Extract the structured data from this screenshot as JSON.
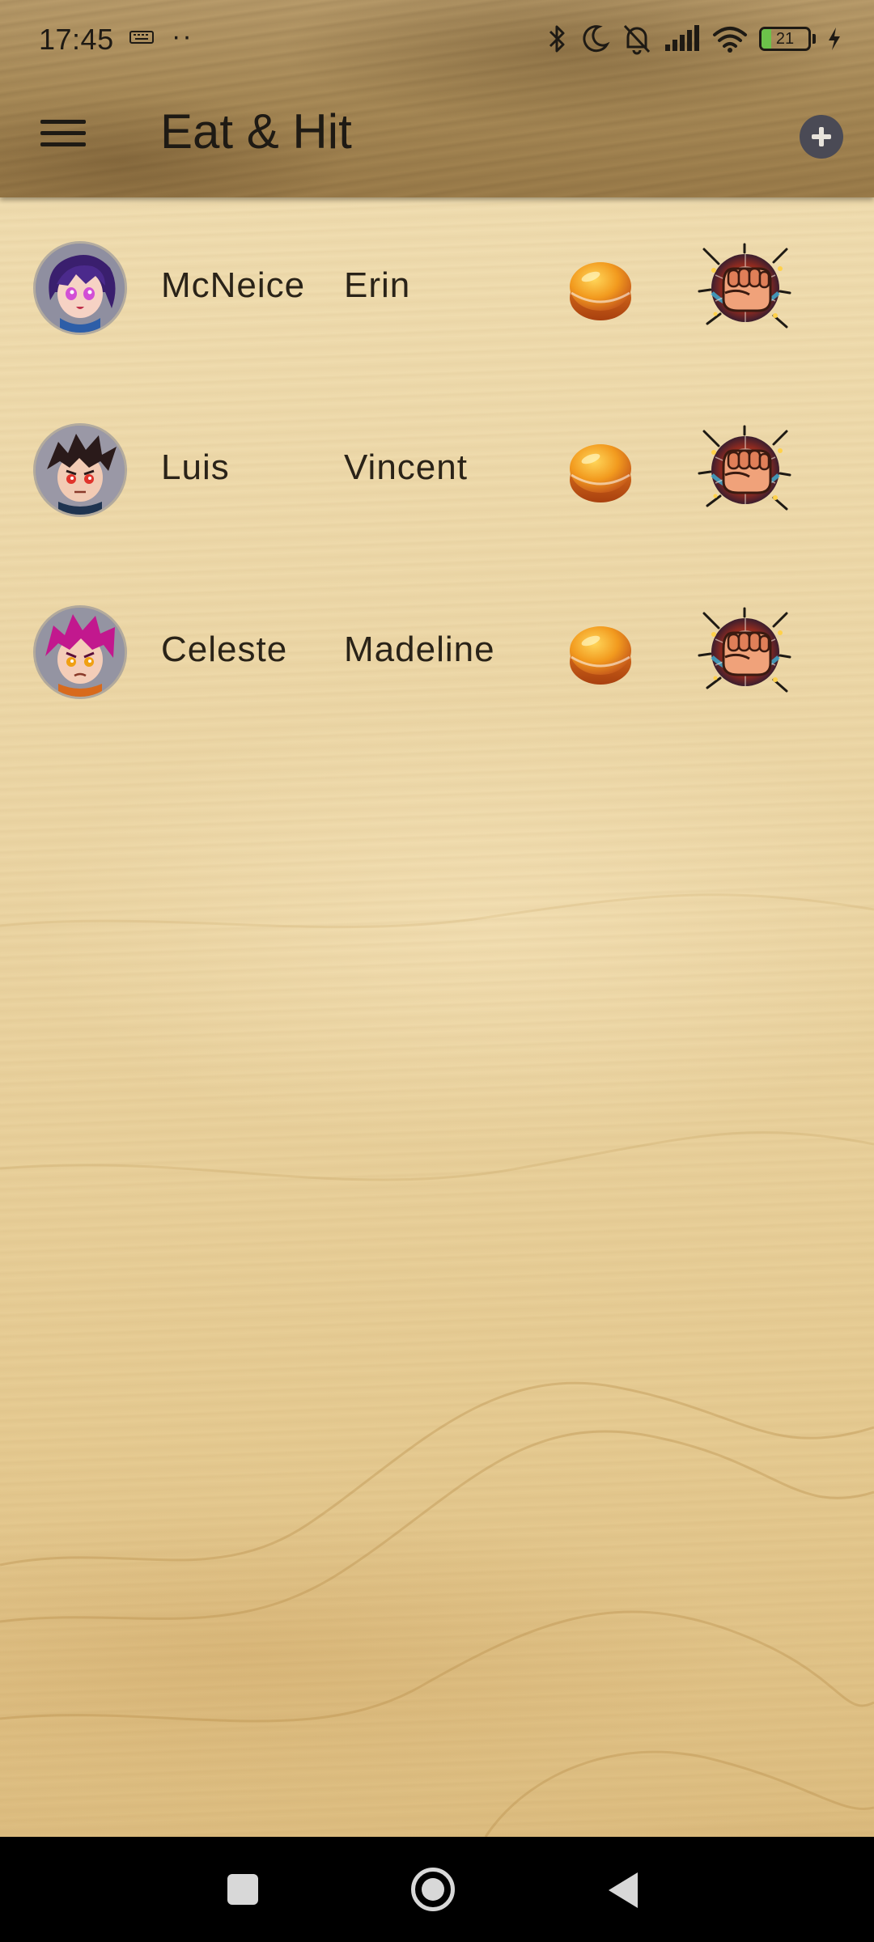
{
  "status_bar": {
    "time": "17:45",
    "battery_level": "21",
    "battery_fraction": 0.21,
    "icons": [
      "keyboard-icon",
      "bluetooth-icon",
      "do-not-disturb-icon",
      "muted-bell-icon",
      "signal-icon",
      "wifi-icon",
      "battery-icon",
      "charging-icon"
    ]
  },
  "app_bar": {
    "title": "Eat & Hit",
    "menu_icon": "hamburger-menu-icon",
    "add_icon": "add-circle-icon"
  },
  "players": [
    {
      "last_name": "McNeice",
      "first_name": "Erin",
      "avatar": "purple-hair-girl-avatar"
    },
    {
      "last_name": "Luis",
      "first_name": "Vincent",
      "avatar": "red-eyes-boy-avatar"
    },
    {
      "last_name": "Celeste",
      "first_name": "Madeline",
      "avatar": "pink-hair-girl-avatar"
    }
  ],
  "row_actions": {
    "eat_icon": "bread-bun-icon",
    "hit_icon": "fist-punch-icon"
  },
  "nav_bar": {
    "buttons": [
      "recents-button",
      "home-button",
      "back-button"
    ]
  },
  "colors": {
    "accent_dark": "#4a4a55",
    "wood_light": "#ecd6a5",
    "wood_dark": "#a88a57"
  }
}
